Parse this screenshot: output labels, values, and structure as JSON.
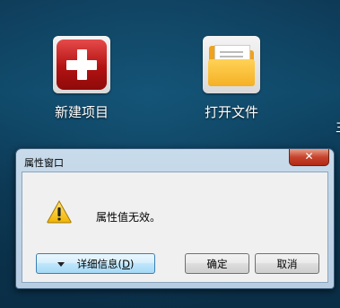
{
  "desktop": {
    "icons": [
      {
        "label": "新建项目",
        "icon": "red-plus-icon"
      },
      {
        "label": "打开文件",
        "icon": "folder-icon"
      }
    ],
    "partial_right_char": "主"
  },
  "dialog": {
    "title": "属性窗口",
    "close_label": "✕",
    "message": "属性值无效。",
    "icon": "warning-icon",
    "details_label": "详细信息(",
    "details_access_key": "D",
    "details_label_end": ")",
    "ok_label": "确定",
    "cancel_label": "取消"
  }
}
